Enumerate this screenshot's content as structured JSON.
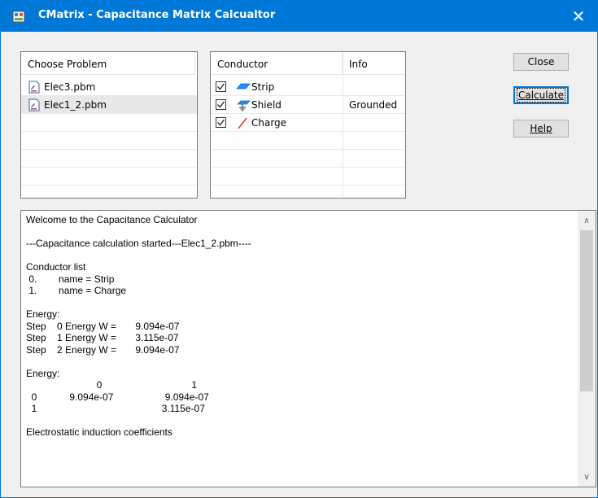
{
  "window": {
    "title": "CMatrix - Capacitance Matrix Calcualtor",
    "close_glyph": "✕"
  },
  "problems": {
    "header": "Choose Problem",
    "items": [
      "Elec3.pbm",
      "Elec1_2.pbm"
    ],
    "selected_index": 1
  },
  "conductors": {
    "headers": [
      "Conductor",
      "Info"
    ],
    "items": [
      {
        "name": "Strip",
        "info": "",
        "checked": true,
        "icon": "strip-conductor-icon",
        "color": "#1e90ff"
      },
      {
        "name": "Shield",
        "info": "Grounded",
        "checked": true,
        "icon": "shield-ground-icon",
        "color": "#1e90ff"
      },
      {
        "name": "Charge",
        "info": "",
        "checked": true,
        "icon": "charge-line-icon",
        "color": "#e02020"
      }
    ]
  },
  "buttons": {
    "close": "Close",
    "calculate": "Calculate",
    "help": "Help"
  },
  "log": {
    "lines": [
      "Welcome to the Capacitance Calculator",
      "",
      "---Capacitance calculation started---Elec1_2.pbm----",
      "",
      "Conductor list",
      " 0.        name = Strip",
      " 1.        name = Charge",
      "",
      "Energy:",
      "Step    0 Energy W =       9.094e-07",
      "Step    1 Energy W =       3.115e-07",
      "Step    2 Energy W =       9.094e-07",
      "",
      "Energy:",
      "                          0                                 1",
      "  0            9.094e-07                   9.094e-07",
      "  1                                              3.115e-07",
      "",
      "Electrostatic induction coefficients"
    ]
  },
  "scrollbar": {
    "up_glyph": "∧",
    "down_glyph": "∨"
  }
}
